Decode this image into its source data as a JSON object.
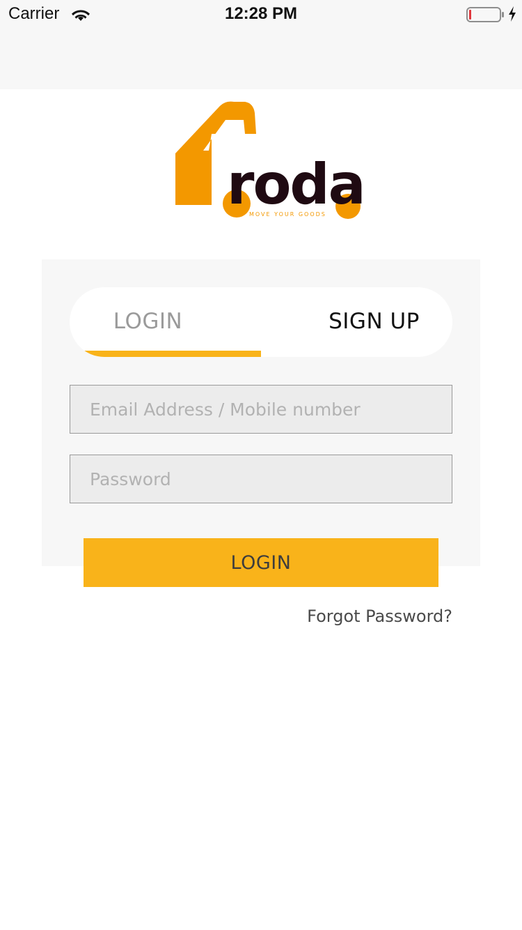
{
  "status_bar": {
    "carrier": "Carrier",
    "time": "12:28 PM",
    "wifi_icon": "wifi-icon",
    "battery_icon": "battery-low-icon",
    "charging_icon": "charging-bolt-icon"
  },
  "logo": {
    "wordmark": "roda",
    "tagline": "MOVE YOUR GOODS",
    "colors": {
      "orange": "#F39800",
      "dark": "#1f0a12"
    }
  },
  "tabs": {
    "items": [
      {
        "label": "LOGIN",
        "active": true
      },
      {
        "label": "SIGN UP",
        "active": false
      }
    ],
    "indicator_color": "#F9B31A"
  },
  "form": {
    "email": {
      "placeholder": "Email Address / Mobile number",
      "value": ""
    },
    "password": {
      "placeholder": "Password",
      "value": ""
    },
    "submit_label": "LOGIN",
    "forgot_label": "Forgot Password?"
  },
  "colors": {
    "accent": "#F9B31A",
    "card_background": "#F7F7F7",
    "input_background": "#ECECEC"
  }
}
